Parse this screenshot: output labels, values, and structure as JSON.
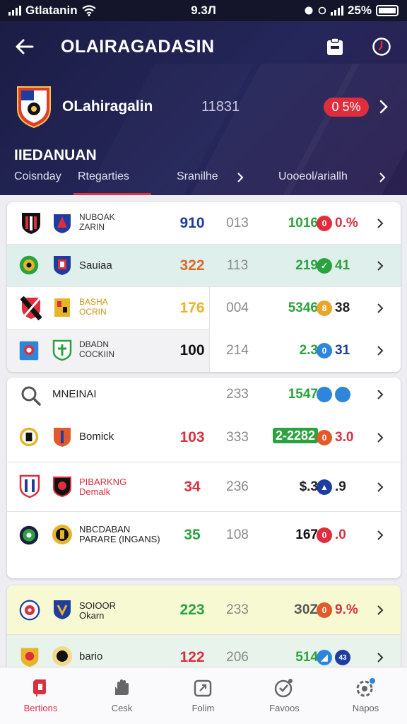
{
  "status_bar": {
    "carrier": "Gtlatanin",
    "time": "9.3Л",
    "battery": "25%"
  },
  "header": {
    "title": "OLAIRAGADASIN",
    "team_name": "OLahiragalin",
    "team_score": "11831",
    "change": "0 5%",
    "section_title": "IIEDANUAN",
    "tabs": [
      {
        "label": "Coisnday"
      },
      {
        "label": "Rtegarties"
      },
      {
        "label": "Sranilhe"
      },
      {
        "label": "Uooeol/ariallh"
      }
    ]
  },
  "colors": {
    "accent": "#d9303f",
    "header_bg": "#1b1d45",
    "positive": "#2aa33e",
    "negative": "#e02d3c"
  },
  "card1": {
    "rows": [
      {
        "name": "NUBOAK\nZARIN",
        "v1": "910",
        "v1_color": "#1e3d9e",
        "v2": "013",
        "v3": "1016",
        "v3_color": "#2aa33e",
        "badge": "0",
        "badge_color": "#e02d3c",
        "pct": "0.%",
        "pct_color": "#d9303f"
      },
      {
        "name": "Sauiaa",
        "v1": "322",
        "v1_color": "#d86a2a",
        "v2": "113",
        "v3": "219",
        "v3_color": "#2aa33e",
        "badge": "✓",
        "badge_color": "#2aa33e",
        "pct": "41",
        "pct_color": "#2aa33e"
      },
      {
        "name": "BASHA\nOCRIN",
        "v1": "176",
        "v1_color": "#e7b52a",
        "v2": "004",
        "v3": "5346",
        "v3_color": "#2aa33e",
        "badge": "8",
        "badge_color": "#e7a62a",
        "pct": "38",
        "pct_color": "#222"
      },
      {
        "name": "DBADN\nCOCKIIN",
        "v1": "100",
        "v1_color": "#111",
        "v2": "214",
        "v3": "2.3",
        "v3_color": "#2aa33e",
        "badge": "0",
        "badge_color": "#2d86d9",
        "pct": "31",
        "pct_color": "#1e3d9e"
      }
    ]
  },
  "card2": {
    "search_label": "MNEINAI",
    "search_v2": "233",
    "search_v3": "1547",
    "rows": [
      {
        "name": "Bomick",
        "v1": "103",
        "v1_color": "#d9303f",
        "v2": "333",
        "v3": "2-2282",
        "badge": "0",
        "badge_color": "#e05a2a",
        "pct": "3.0",
        "pct_color": "#d9303f"
      },
      {
        "name": "PIBARKNG\nDemalk",
        "v1": "34",
        "v1_color": "#d9303f",
        "v2": "236",
        "v3": "$.3",
        "v3_color": "#222",
        "badge": "▲",
        "badge_color": "#1e3d9e",
        "pct": ".9",
        "pct_color": "#222"
      },
      {
        "name": "NBCDABAN\nPARARE (INGANS)",
        "v1": "35",
        "v1_color": "#2aa33e",
        "v2": "108",
        "v3": "167",
        "v3_color": "#111",
        "badge": "0",
        "badge_color": "#e02d3c",
        "pct": ".0",
        "pct_color": "#d9303f"
      }
    ]
  },
  "card3": {
    "rows": [
      {
        "name": "SOIOOR\nOkarn",
        "v1": "223",
        "v1_color": "#2aa33e",
        "v2": "233",
        "v3": "З0Z",
        "v3_color": "#555",
        "badge": "0",
        "badge_color": "#e05a2a",
        "pct": "9.%",
        "pct_color": "#d9303f"
      },
      {
        "name": "bario",
        "v1": "122",
        "v1_color": "#d9303f",
        "v2": "206",
        "v3": "514",
        "v3_color": "#2aa33e",
        "badge": "◢",
        "badge_color": "#2d86d9",
        "pct": "43",
        "pct_color": "#1e3d9e"
      }
    ]
  },
  "bottom_nav": [
    {
      "label": "Bertions",
      "icon": "flag-icon"
    },
    {
      "label": "Cesk",
      "icon": "hand-icon"
    },
    {
      "label": "Folim",
      "icon": "form-icon"
    },
    {
      "label": "Favoos",
      "icon": "star-badge-icon"
    },
    {
      "label": "Napos",
      "icon": "settings-icon"
    }
  ]
}
